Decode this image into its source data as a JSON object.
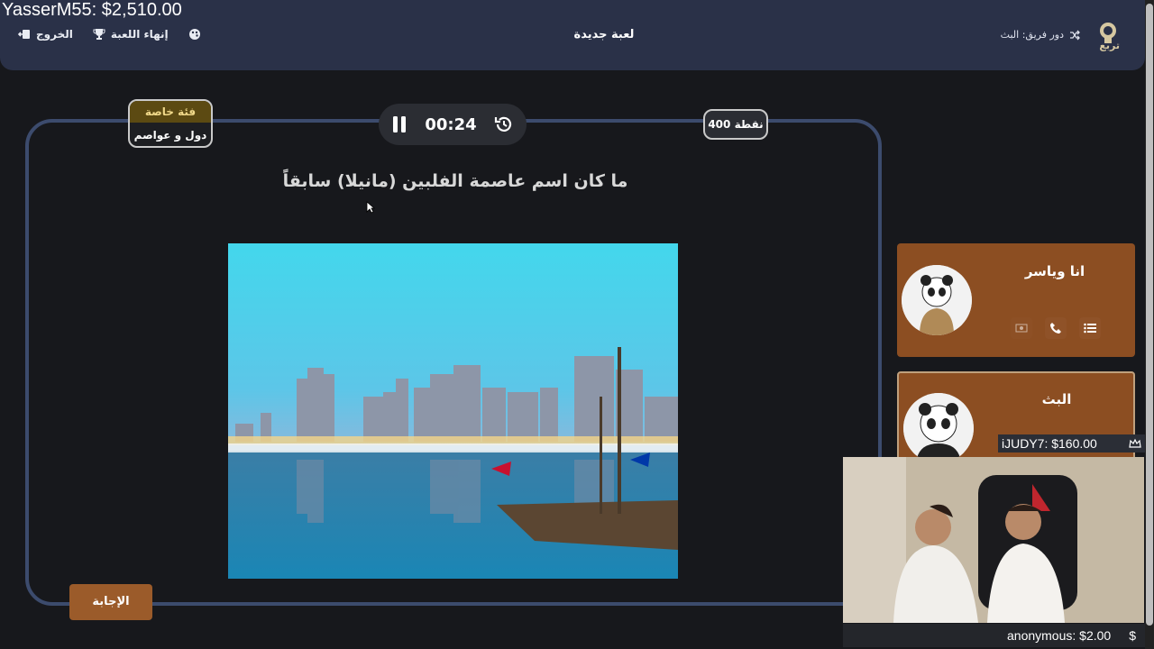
{
  "overlay": {
    "top_donation": "YasserM55: $2,510.00",
    "side_donation": "iJUDY7: $160.00",
    "bottom_donation": "anonymous: $2.00",
    "dollar_icon": "$"
  },
  "header": {
    "title": "لعبة جديدة",
    "exit_label": "الخروج",
    "end_game_label": "إنهاء اللعبة",
    "turn_label": "دور فريق: البث",
    "logo_text": "تربع"
  },
  "board": {
    "category_label": "فئة خاصة",
    "category_name": "دول و عواصم",
    "timer": "00:24",
    "points": "400 نقطة",
    "question": "ما كان اسم عاصمة الفلبين (مانيلا) سابقاً",
    "answer_button": "الإجابة"
  },
  "teams": [
    {
      "name": "انا وياسر"
    },
    {
      "name": "البث"
    }
  ],
  "colors": {
    "header_bg": "#2a3148",
    "board_border": "#3c4b6d",
    "team_bg": "#8c4e22",
    "answer_bg": "#9b5b2a"
  }
}
